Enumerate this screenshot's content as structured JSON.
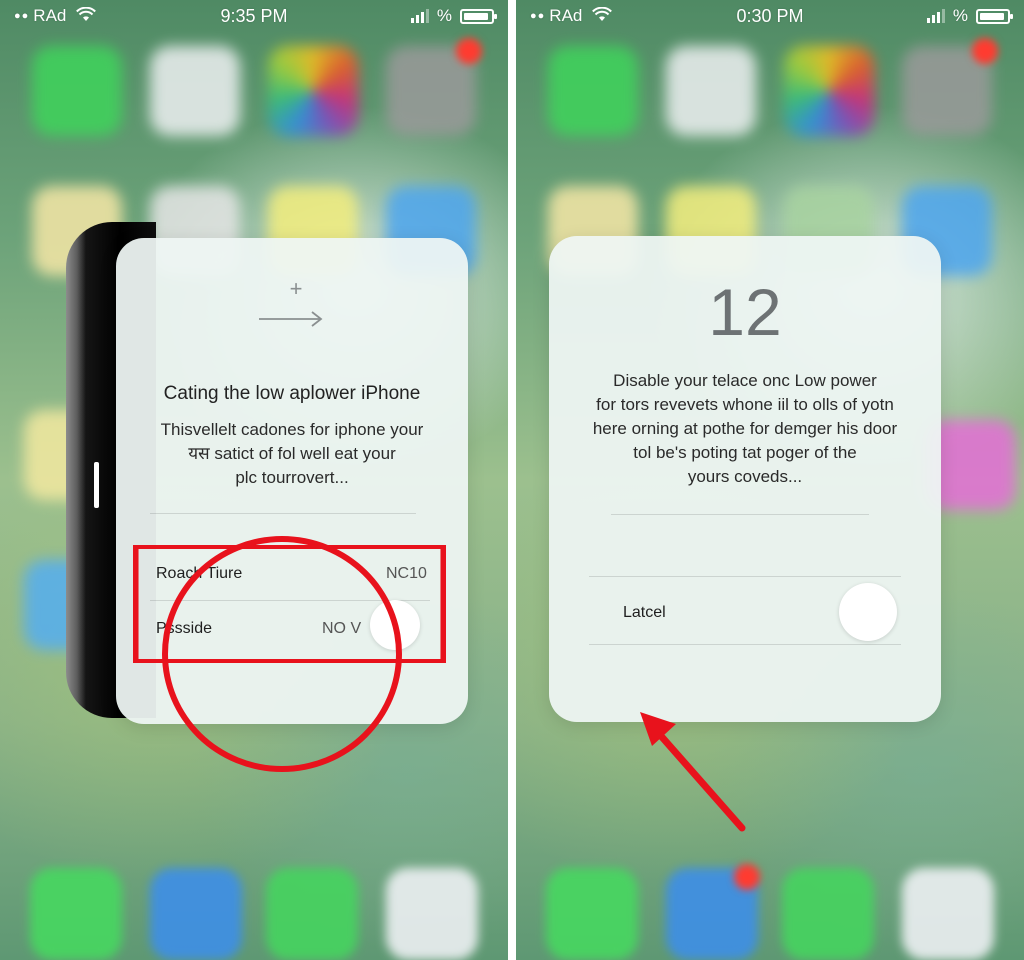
{
  "left_screen": {
    "status": {
      "carrier": "RAd",
      "time": "9:35 PM",
      "battery_text": "%"
    },
    "card": {
      "icon": "arrow-right-icon",
      "plus_glyph": "+",
      "title": "Cating the low aplower iPhone",
      "body_lines": [
        "Thisvellelt cadones for iphone your",
        "यस satict  of fol well eat your",
        "plc tourrovert..."
      ],
      "rows": [
        {
          "label": "Roach Tiure",
          "value": "NC10"
        },
        {
          "label": "Pssside",
          "value": "NO V"
        }
      ]
    }
  },
  "right_screen": {
    "status": {
      "carrier": "RAd",
      "time": "0:30 PM",
      "battery_text": "%"
    },
    "card": {
      "big_number": "12",
      "body_lines": [
        "Disable your telace onc Low power",
        "for tors revevets whone iil to olls of yotn",
        "here orning at pothe for demger his door",
        "tol be's poting tat poger of the",
        "yours coveds..."
      ],
      "row": {
        "label": "Latcel"
      }
    }
  },
  "colors": {
    "highlight": "#e8121c",
    "card": "#eef5f3"
  }
}
